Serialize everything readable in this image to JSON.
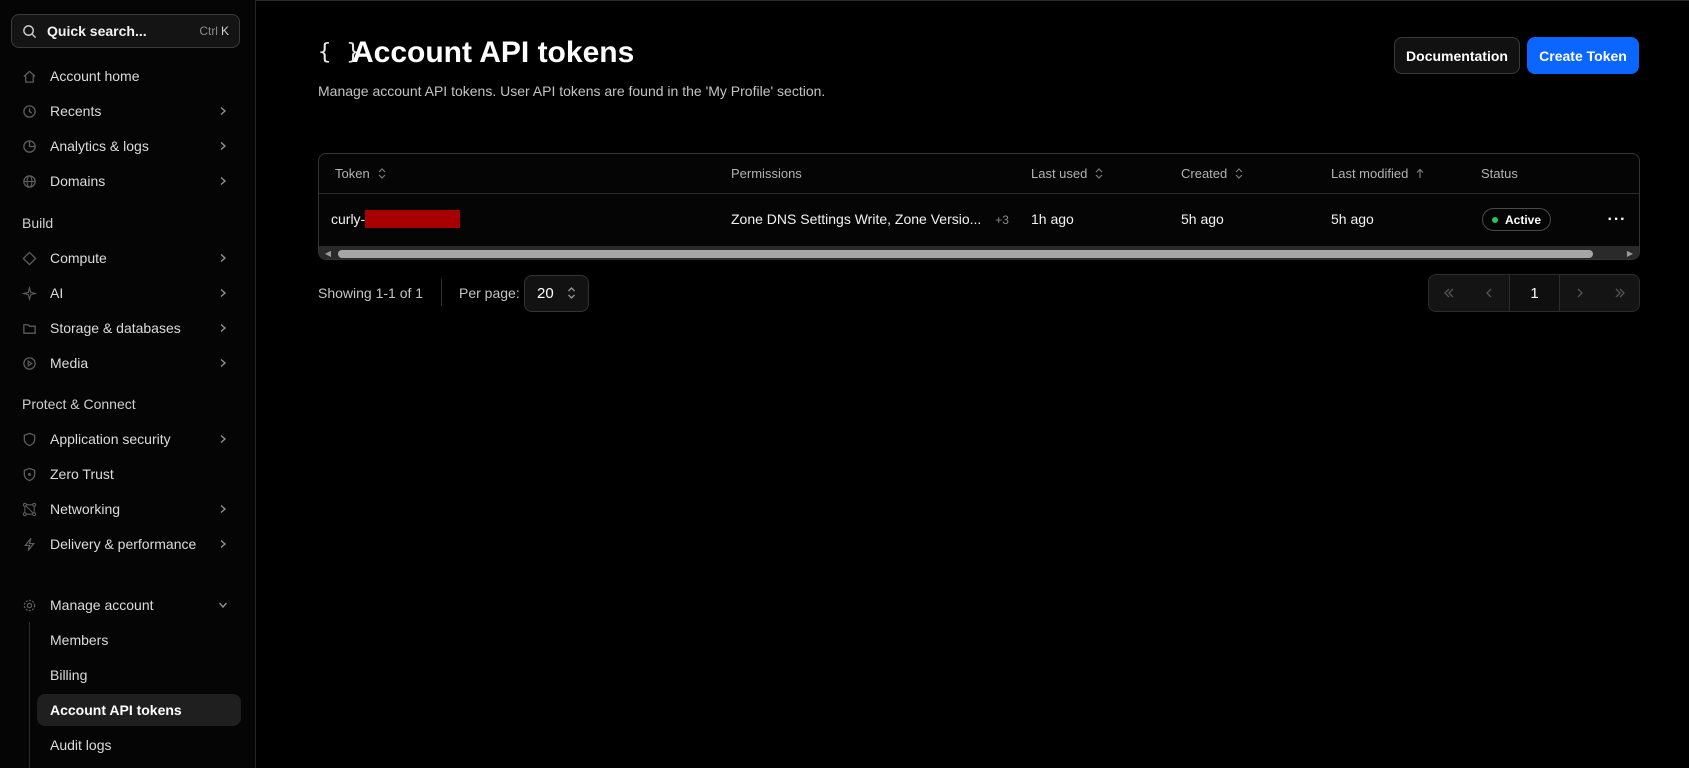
{
  "sidebar": {
    "search": {
      "label": "Quick search...",
      "shortcut_mod": "Ctrl",
      "shortcut_key": "K"
    },
    "items": [
      {
        "label": "Account home",
        "icon": "home-icon"
      },
      {
        "label": "Recents",
        "icon": "history-icon"
      },
      {
        "label": "Analytics & logs",
        "icon": "chart-pie-icon"
      },
      {
        "label": "Domains",
        "icon": "globe-icon"
      },
      {
        "label": "Compute",
        "icon": "diamond-icon"
      },
      {
        "label": "AI",
        "icon": "sparkles-icon"
      },
      {
        "label": "Storage & databases",
        "icon": "folder-icon"
      },
      {
        "label": "Media",
        "icon": "play-circle-icon"
      },
      {
        "label": "Application security",
        "icon": "shield-icon"
      },
      {
        "label": "Zero Trust",
        "icon": "shield-lock-icon"
      },
      {
        "label": "Networking",
        "icon": "network-icon"
      },
      {
        "label": "Delivery & performance",
        "icon": "bolt-icon"
      },
      {
        "label": "Manage account",
        "icon": "gear-icon"
      }
    ],
    "sections": {
      "build": "Build",
      "protect": "Protect & Connect"
    },
    "sub_items": [
      "Members",
      "Billing",
      "Account API tokens",
      "Audit logs"
    ]
  },
  "header": {
    "title_icon": "{ }",
    "title": "Account API tokens",
    "description": "Manage account API tokens. User API tokens are found in the 'My Profile' section.",
    "documentation_label": "Documentation",
    "create_label": "Create Token"
  },
  "table": {
    "columns": [
      "Token",
      "Permissions",
      "Last used",
      "Created",
      "Last modified",
      "Status"
    ],
    "rows": [
      {
        "token": "curly-",
        "permissions": "Zone DNS Settings Write, Zone Versio...",
        "permissions_more": "+3",
        "last_used": "1h ago",
        "created": "5h ago",
        "last_modified": "5h ago",
        "status": "Active"
      }
    ]
  },
  "footer": {
    "showing": "Showing 1-1 of 1",
    "per_page_label": "Per page:",
    "per_page_value": "20",
    "current_page": "1"
  },
  "colors": {
    "accent": "#0a66ff",
    "status_active": "#22c55e",
    "background": "#000000"
  }
}
